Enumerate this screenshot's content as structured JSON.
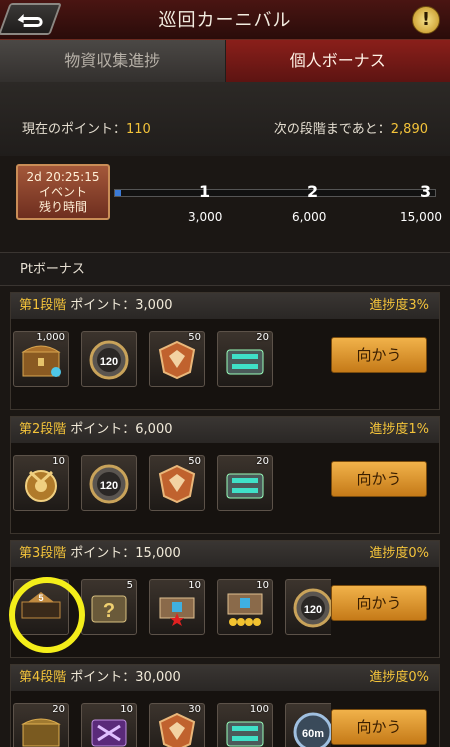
{
  "header": {
    "title": "巡回カーニバル",
    "help_label": "!"
  },
  "tabs": [
    {
      "label": "物資収集進捗",
      "active": false
    },
    {
      "label": "個人ボーナス",
      "active": true
    }
  ],
  "points": {
    "current_label": "現在のポイント：",
    "current_value": "110",
    "next_label": "次の段階まであと：",
    "next_value": "2,890"
  },
  "timer": {
    "time": "2d 20:25:15",
    "line1": "イベント",
    "line2": "残り時間"
  },
  "timeline": {
    "progress_fraction": 0.02,
    "steps": [
      {
        "num": "1",
        "value": "3,000"
      },
      {
        "num": "2",
        "value": "6,000"
      },
      {
        "num": "3",
        "value": "15,000"
      }
    ]
  },
  "section_title": "Ptボーナス",
  "go_label": "向かう",
  "stages": [
    {
      "name": "第1段階",
      "points": "ポイント：3,000",
      "progress": "進捗度3%",
      "items": [
        {
          "icon": "treasure-chest-icon",
          "count": "1,000"
        },
        {
          "icon": "speedup-120-icon",
          "count": ""
        },
        {
          "icon": "badge-icon",
          "count": "50"
        },
        {
          "icon": "supply-crate-icon",
          "count": "20"
        }
      ]
    },
    {
      "name": "第2段階",
      "points": "ポイント：6,000",
      "progress": "進捗度1%",
      "items": [
        {
          "icon": "medal-icon",
          "count": "10"
        },
        {
          "icon": "speedup-120-icon",
          "count": ""
        },
        {
          "icon": "badge-icon",
          "count": "50"
        },
        {
          "icon": "supply-crate-icon",
          "count": "20"
        }
      ]
    },
    {
      "name": "第3段階",
      "points": "ポイント：15,000",
      "progress": "進捗度0%",
      "items": [
        {
          "icon": "stage-5-icon",
          "count": ""
        },
        {
          "icon": "mystery-box-icon",
          "count": "5"
        },
        {
          "icon": "chest-1star-icon",
          "count": "10"
        },
        {
          "icon": "chest-4star-icon",
          "count": "10"
        },
        {
          "icon": "speedup-120-icon",
          "count": ""
        }
      ]
    },
    {
      "name": "第4段階",
      "points": "ポイント：30,000",
      "progress": "進捗度0%",
      "items": [
        {
          "icon": "gold-chest-icon",
          "count": "20"
        },
        {
          "icon": "purple-crate-icon",
          "count": "10"
        },
        {
          "icon": "badge-icon",
          "count": "30"
        },
        {
          "icon": "supply-crate-icon",
          "count": "100"
        },
        {
          "icon": "speedup-60m-icon",
          "count": ""
        }
      ]
    }
  ],
  "highlight_stage_item": {
    "stage": 3,
    "item": 1,
    "label": "5"
  },
  "speedup_label": "120",
  "speedup60_label": "60m"
}
